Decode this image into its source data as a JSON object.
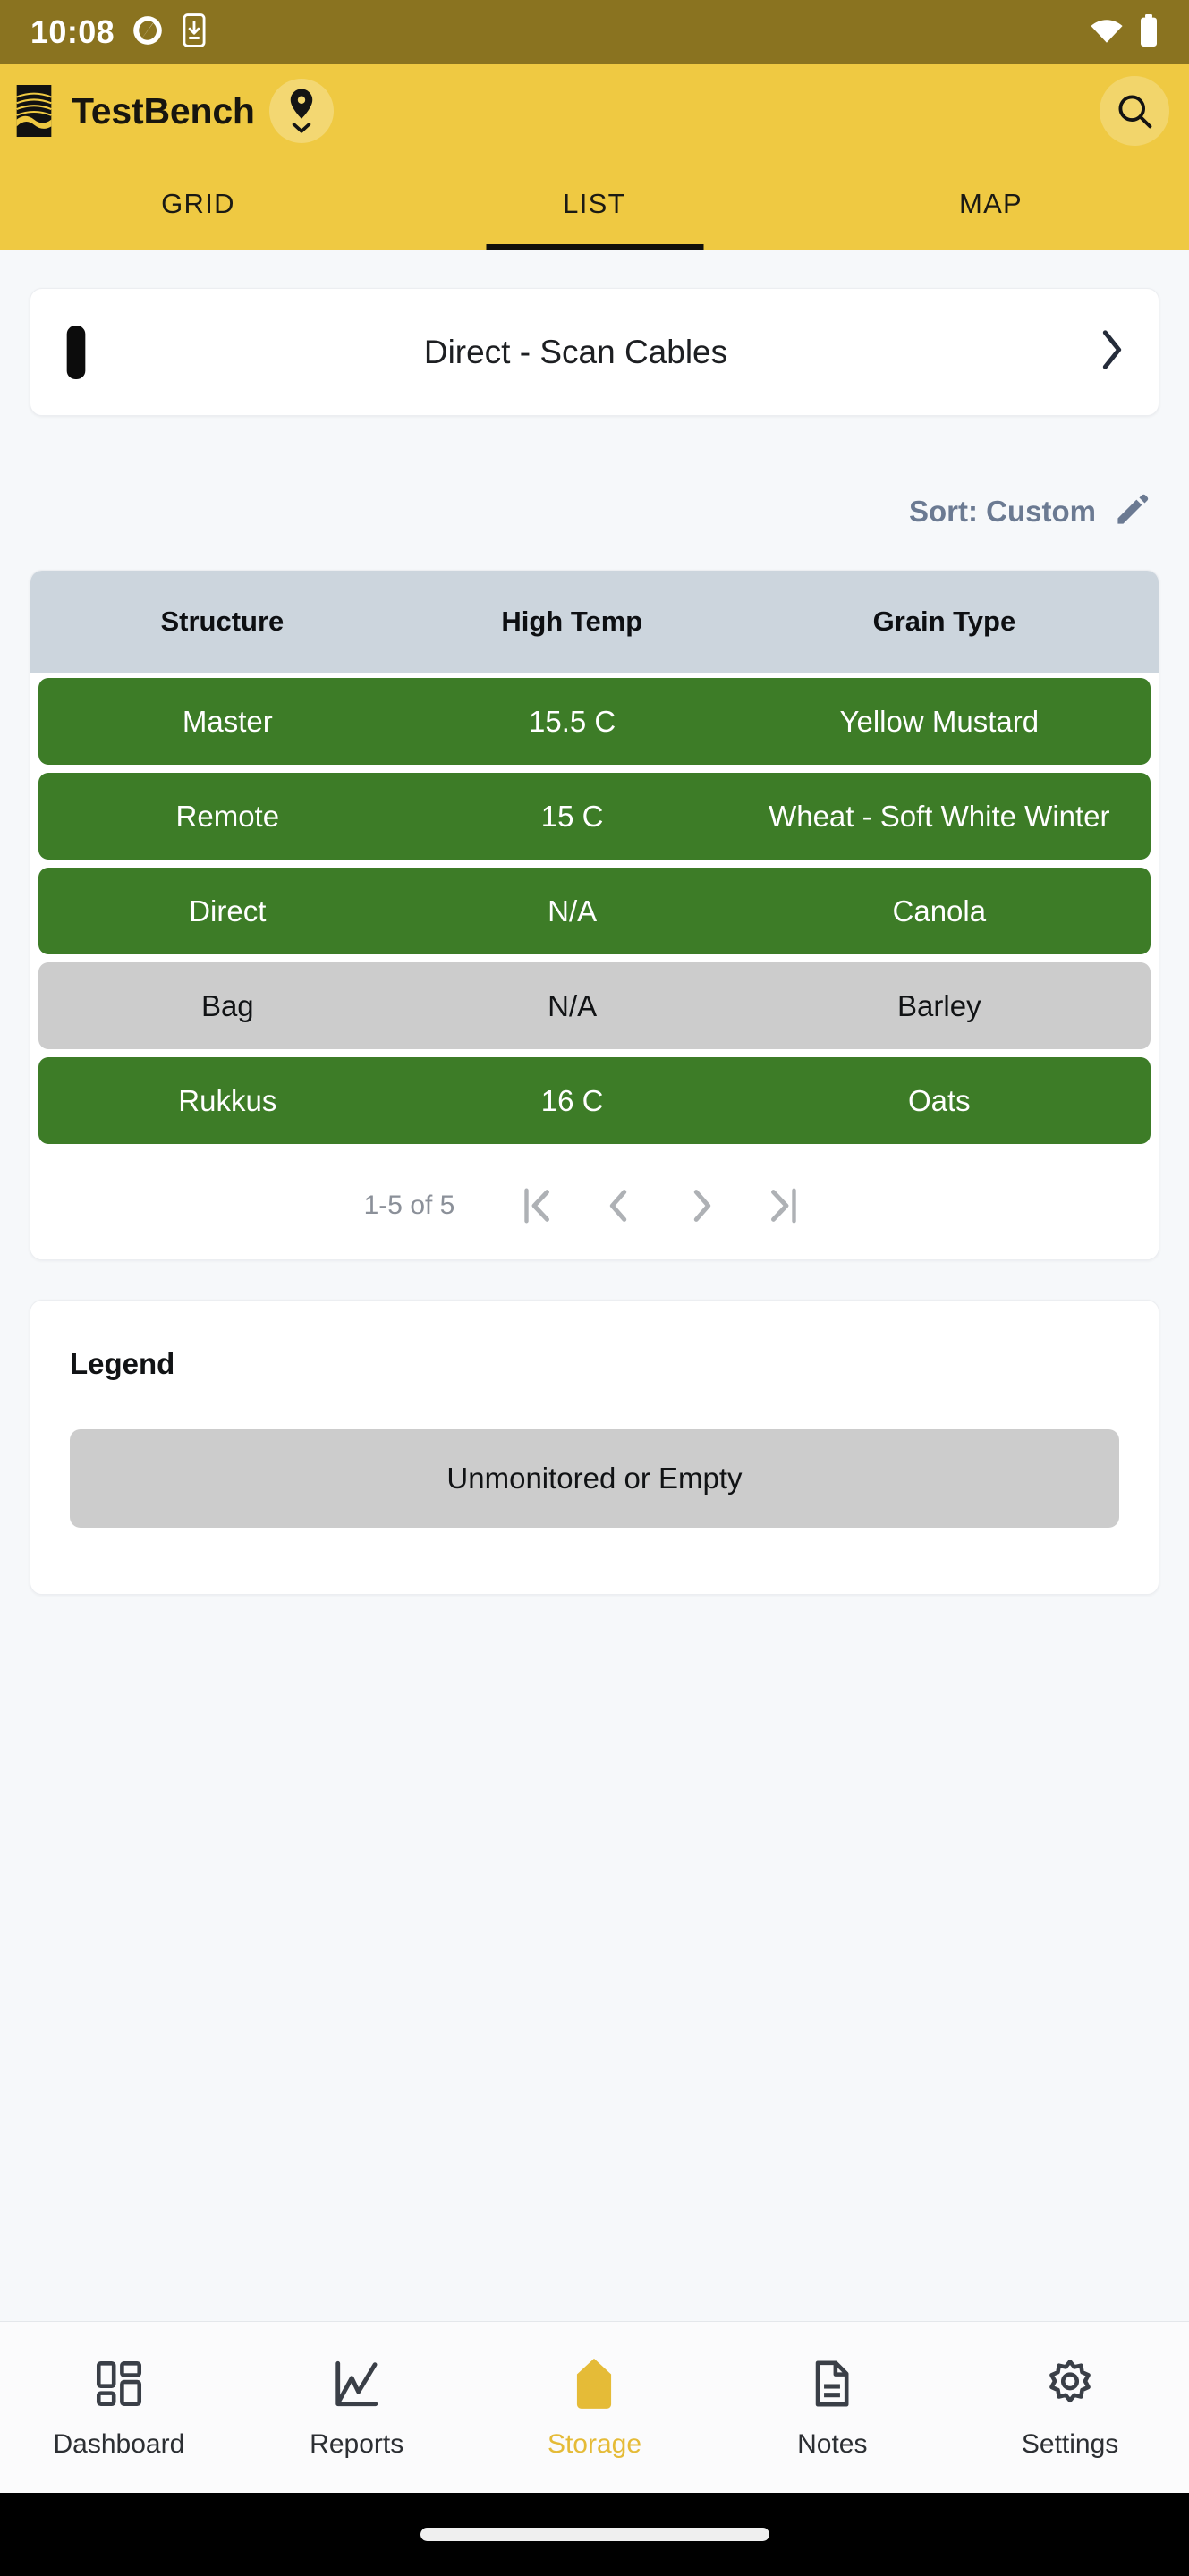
{
  "status_bar": {
    "time": "10:08",
    "icons": [
      "sync-app-icon",
      "download-phone-icon",
      "wifi-icon",
      "battery-icon"
    ],
    "background": "#8a7320"
  },
  "app_bar": {
    "brand_title": "TestBench",
    "logo_icon": "grain-bin-logo-icon",
    "location_icon": "location-pin-dropdown-icon",
    "search_icon": "search-icon",
    "background": "#efc942"
  },
  "tabs": {
    "items": [
      {
        "label": "GRID",
        "active": false
      },
      {
        "label": "LIST",
        "active": true
      },
      {
        "label": "MAP",
        "active": false
      }
    ]
  },
  "scan_card": {
    "icon": "cable-probe-icon",
    "label": "Direct - Scan Cables",
    "chevron_icon": "chevron-right-icon"
  },
  "sort": {
    "label": "Sort: Custom",
    "edit_icon": "pencil-edit-icon",
    "color": "#6b7a92"
  },
  "table": {
    "columns": [
      "Structure",
      "High Temp",
      "Grain Type"
    ],
    "rows": [
      {
        "structure": "Master",
        "high_temp": "15.5 C",
        "grain_type": "Yellow Mustard",
        "state": "monitored"
      },
      {
        "structure": "Remote",
        "high_temp": "15 C",
        "grain_type": "Wheat - Soft White Winter",
        "state": "monitored"
      },
      {
        "structure": "Direct",
        "high_temp": "N/A",
        "grain_type": "Canola",
        "state": "monitored"
      },
      {
        "structure": "Bag",
        "high_temp": "N/A",
        "grain_type": "Barley",
        "state": "unmonitored"
      },
      {
        "structure": "Rukkus",
        "high_temp": "16 C",
        "grain_type": "Oats",
        "state": "monitored"
      }
    ],
    "colors": {
      "monitored": "#3d7c27",
      "unmonitored": "#cccccc",
      "header": "#ccd5dd"
    }
  },
  "pagination": {
    "range_text": "1-5 of 5",
    "first_icon": "first-page-icon",
    "prev_icon": "previous-page-icon",
    "next_icon": "next-page-icon",
    "last_icon": "last-page-icon"
  },
  "legend": {
    "title": "Legend",
    "items": [
      {
        "label": "Unmonitored or Empty",
        "color": "#cccccc"
      }
    ]
  },
  "bottom_nav": {
    "active_color": "#e5bb37",
    "items": [
      {
        "label": "Dashboard",
        "icon": "dashboard-grid-icon",
        "active": false
      },
      {
        "label": "Reports",
        "icon": "line-chart-icon",
        "active": false
      },
      {
        "label": "Storage",
        "icon": "grain-bin-icon",
        "active": true
      },
      {
        "label": "Notes",
        "icon": "document-notes-icon",
        "active": false
      },
      {
        "label": "Settings",
        "icon": "gear-icon",
        "active": false
      }
    ]
  },
  "gesture_bar": {
    "indicator": "home-indicator"
  }
}
